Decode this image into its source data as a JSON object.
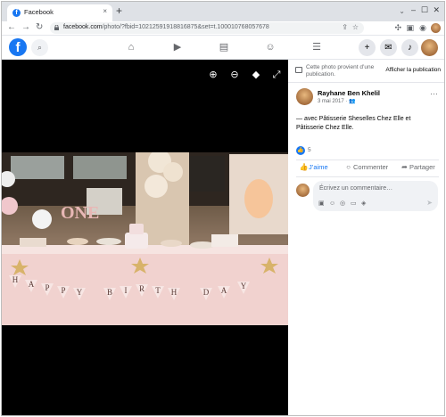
{
  "browser": {
    "tab_title": "Facebook",
    "tab_close": "×",
    "new_tab": "+",
    "tab_search": "⌄",
    "url_host": "facebook.com",
    "url_path": "/photo/?fbid=10212591918816875&set=t.100010768057678",
    "minimize": "–",
    "maximize": "☐",
    "close": "✕",
    "back": "←",
    "forward": "→",
    "reload": "↻"
  },
  "fb_header": {
    "logo": "f"
  },
  "viewer": {
    "tools": [
      "zoom-in-icon",
      "zoom-out-icon",
      "tag-icon",
      "fullscreen-icon"
    ]
  },
  "panel": {
    "notice": "Cette photo provient d’une publication.",
    "notice_link": "Afficher la publication",
    "author": "Rayhane Ben Khelil",
    "date": "3 mai 2017 ·",
    "more": "···",
    "text": "— avec Pâtisserie Sheselles Chez Elle et Pâtisserie Chez Elle.",
    "likes": "5",
    "like_label": "J’aime",
    "comment_label": "Commenter",
    "share_label": "Partager",
    "comment_placeholder": "Écrivez un commentaire…"
  },
  "colors": {
    "fb_blue": "#1877f2",
    "viewer_bg": "#000000",
    "chrome_tabstrip": "#dee1e6"
  }
}
